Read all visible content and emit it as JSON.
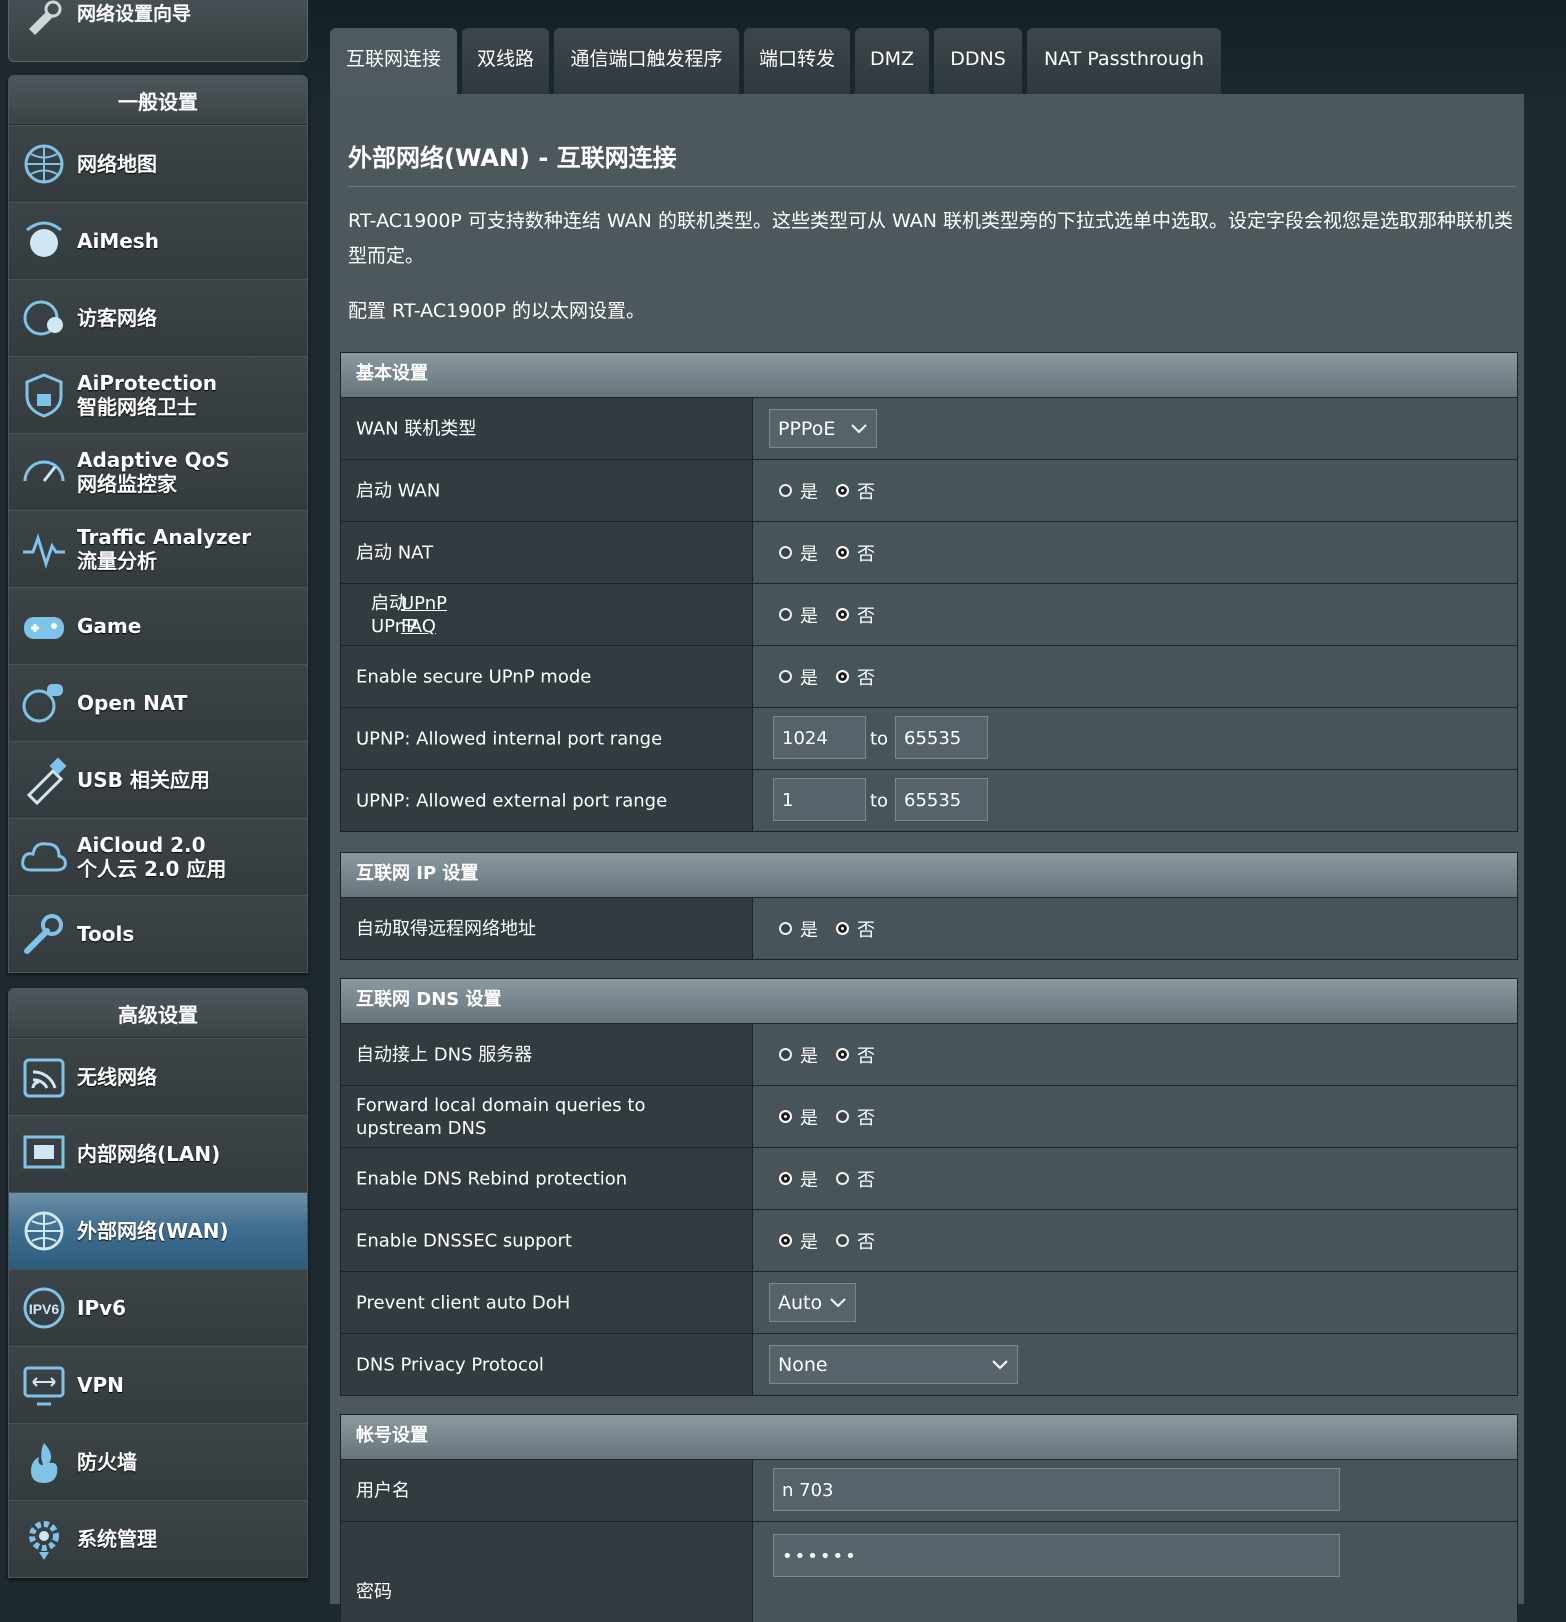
{
  "sidebar": {
    "top_item": {
      "label": "网络设置向导",
      "icon": "wrench-wizard-icon"
    },
    "general": {
      "title": "一般设置",
      "items": [
        {
          "lines": [
            "网络地图"
          ],
          "icon": "globe-map-icon"
        },
        {
          "lines": [
            "AiMesh"
          ],
          "icon": "aimesh-icon"
        },
        {
          "lines": [
            "访客网络"
          ],
          "icon": "guest-globe-icon"
        },
        {
          "lines": [
            "AiProtection",
            "智能网络卫士"
          ],
          "icon": "shield-lock-icon"
        },
        {
          "lines": [
            "Adaptive QoS",
            "网络监控家"
          ],
          "icon": "speedometer-icon"
        },
        {
          "lines": [
            "Traffic Analyzer",
            "流量分析"
          ],
          "icon": "pulse-icon"
        },
        {
          "lines": [
            "Game"
          ],
          "icon": "gamepad-icon"
        },
        {
          "lines": [
            "Open NAT"
          ],
          "icon": "open-nat-icon"
        },
        {
          "lines": [
            "USB 相关应用"
          ],
          "icon": "usb-icon"
        },
        {
          "lines": [
            "AiCloud 2.0",
            "个人云 2.0 应用"
          ],
          "icon": "cloud-icon"
        },
        {
          "lines": [
            "Tools"
          ],
          "icon": "wrench-icon"
        }
      ]
    },
    "advanced": {
      "title": "高级设置",
      "items": [
        {
          "lines": [
            "无线网络"
          ],
          "icon": "wifi-icon"
        },
        {
          "lines": [
            "内部网络(LAN)"
          ],
          "icon": "lan-icon"
        },
        {
          "lines": [
            "外部网络(WAN)"
          ],
          "icon": "globe-icon",
          "active": true
        },
        {
          "lines": [
            "IPv6"
          ],
          "icon": "ipv6-icon"
        },
        {
          "lines": [
            "VPN"
          ],
          "icon": "vpn-icon"
        },
        {
          "lines": [
            "防火墙"
          ],
          "icon": "firewall-icon"
        },
        {
          "lines": [
            "系统管理"
          ],
          "icon": "gear-icon"
        }
      ]
    }
  },
  "tabs": [
    "互联网连接",
    "双线路",
    "通信端口触发程序",
    "端口转发",
    "DMZ",
    "DDNS",
    "NAT Passthrough"
  ],
  "page": {
    "title": "外部网络(WAN) - 互联网连接",
    "description": "RT-AC1900P 可支持数种连结 WAN 的联机类型。这些类型可从 WAN 联机类型旁的下拉式选单中选取。设定字段会视您是选取那种联机类型而定。",
    "config_note": "配置 RT-AC1900P 的以太网设置。"
  },
  "radio_labels": {
    "yes": "是",
    "no": "否"
  },
  "basic": {
    "title": "基本设置",
    "wan_type_label": "WAN 联机类型",
    "wan_type_value": "PPPoE",
    "enable_wan_label": "启动 WAN",
    "enable_nat_label": "启动 NAT",
    "enable_upnp_label": "启动 UPnP",
    "upnp_faq_link": "UPnP FAQ",
    "secure_upnp_label": "Enable secure UPnP mode",
    "int_range_label": "UPNP: Allowed internal port range",
    "int_range_from": "1024",
    "int_range_to": "65535",
    "ext_range_label": "UPNP: Allowed external port range",
    "ext_range_from": "1",
    "ext_range_to": "65535",
    "to_word": "to"
  },
  "ip": {
    "title": "互联网 IP 设置",
    "auto_ip_label": "自动取得远程网络地址"
  },
  "dns": {
    "title": "互联网 DNS 设置",
    "auto_dns_label": "自动接上 DNS 服务器",
    "forward_label": "Forward local domain queries to upstream DNS",
    "rebind_label": "Enable DNS Rebind protection",
    "dnssec_label": "Enable DNSSEC support",
    "doh_label": "Prevent client auto DoH",
    "doh_value": "Auto",
    "privacy_label": "DNS Privacy Protocol",
    "privacy_value": "None"
  },
  "account": {
    "title": "帐号设置",
    "username_label": "用户名",
    "username_value": "n          703",
    "password_label": "密码",
    "password_value": "••••••"
  }
}
